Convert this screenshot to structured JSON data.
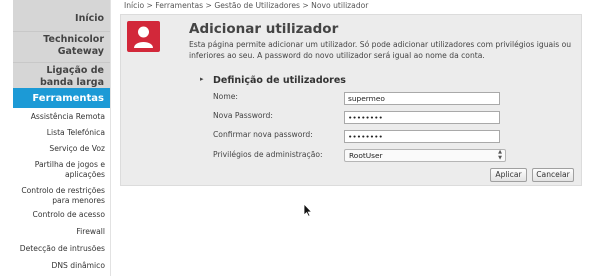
{
  "sidebar": {
    "top_items": [
      "Início",
      "Technicolor Gateway",
      "Ligação de banda larga"
    ],
    "active_section": "Ferramentas",
    "sub_items": [
      "Assistência Remota",
      "Lista Telefónica",
      "Serviço de Voz",
      "Partilha de jogos e aplicações",
      "Controlo de restrições para menores",
      "Controlo de acesso",
      "Firewall",
      "Detecção de intrusões",
      "DNS dinâmico"
    ]
  },
  "breadcrumb": "Início > Ferramentas > Gestão de Utilizadores > Novo utilizador",
  "main": {
    "title": "Adicionar utilizador",
    "intro": "Esta página permite adicionar um utilizador. Só pode adicionar utilizadores com privilégios iguais ou inferiores ao seu. A password do novo utilizador será igual ao nome da conta.",
    "section_title": "Definição de utilizadores",
    "form": {
      "name_label": "Nome:",
      "name_value": "supermeo",
      "password_label": "Nova Password:",
      "password_value": "••••••••",
      "confirm_label": "Confirmar nova password:",
      "confirm_value": "••••••••",
      "privileges_label": "Privilégios de administração:",
      "privileges_value": "RootUser"
    },
    "apply_label": "Aplicar",
    "cancel_label": "Cancelar"
  },
  "colors": {
    "accent": "#1c9ad6",
    "user_icon": "#d2283a"
  }
}
